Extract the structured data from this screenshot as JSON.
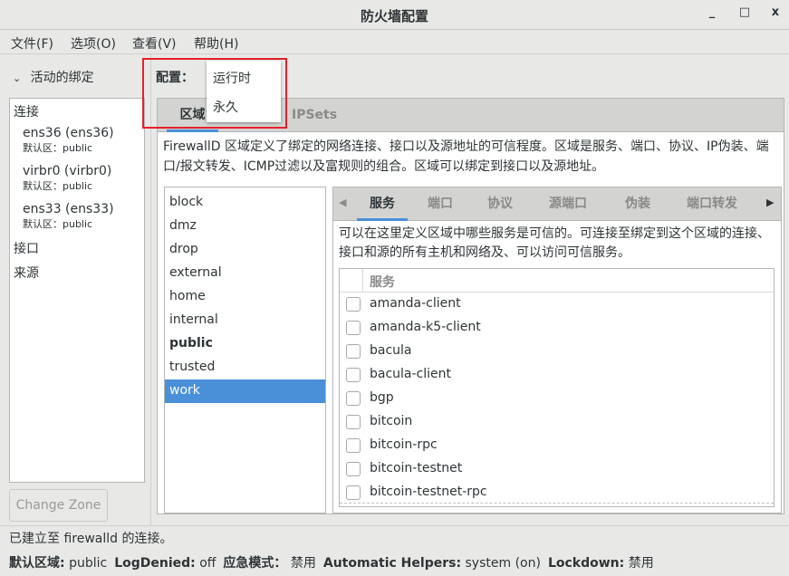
{
  "window": {
    "title": "防火墙配置",
    "minimize": "_",
    "maximize": "□",
    "close": "x"
  },
  "menu": [
    "文件(F)",
    "选项(O)",
    "查看(V)",
    "帮助(H)"
  ],
  "left": {
    "header": "活动的绑定",
    "items": [
      {
        "label": "连接",
        "type": "section"
      },
      {
        "label": "ens36 (ens36)",
        "sub": "默认区：public"
      },
      {
        "label": "virbr0 (virbr0)",
        "sub": "默认区：public"
      },
      {
        "label": "ens33 (ens33)",
        "sub": "默认区：public"
      },
      {
        "label": "接口",
        "type": "section"
      },
      {
        "label": "来源",
        "type": "section"
      }
    ],
    "change_zone": "Change Zone"
  },
  "config": {
    "label": "配置：",
    "options": [
      "运行时",
      "永久"
    ],
    "highlight_color": "#e8202a"
  },
  "tabs": [
    "区域",
    "IPSets"
  ],
  "zone_desc": "FirewallD 区域定义了绑定的网络连接、接口以及源地址的可信程度。区域是服务、端口、协议、IP伪装、端口/报文转发、ICMP过滤以及富规则的组合。区域可以绑定到接口以及源地址。",
  "zones": [
    "block",
    "dmz",
    "drop",
    "external",
    "home",
    "internal",
    "public",
    "trusted",
    "work"
  ],
  "selected_zone": "work",
  "default_zone": "public",
  "inner_tabs": [
    "服务",
    "端口",
    "协议",
    "源端口",
    "伪装",
    "端口转发"
  ],
  "services_desc": "可以在这里定义区域中哪些服务是可信的。可连接至绑定到这个区域的连接、接口和源的所有主机和网络及、可以访问可信服务。",
  "services_header": "服务",
  "services": [
    "amanda-client",
    "amanda-k5-client",
    "bacula",
    "bacula-client",
    "bgp",
    "bitcoin",
    "bitcoin-rpc",
    "bitcoin-testnet",
    "bitcoin-testnet-rpc"
  ],
  "status": {
    "message": "已建立至  firewalld 的连接。",
    "fields": [
      {
        "k": "默认区域:",
        "v": "public"
      },
      {
        "k": "LogDenied:",
        "v": "off"
      },
      {
        "k": "应急模式：",
        "v": "禁用"
      },
      {
        "k": "Automatic Helpers:",
        "v": "system (on)"
      },
      {
        "k": "Lockdown:",
        "v": "禁用"
      }
    ]
  },
  "accent": "#4a90d9"
}
